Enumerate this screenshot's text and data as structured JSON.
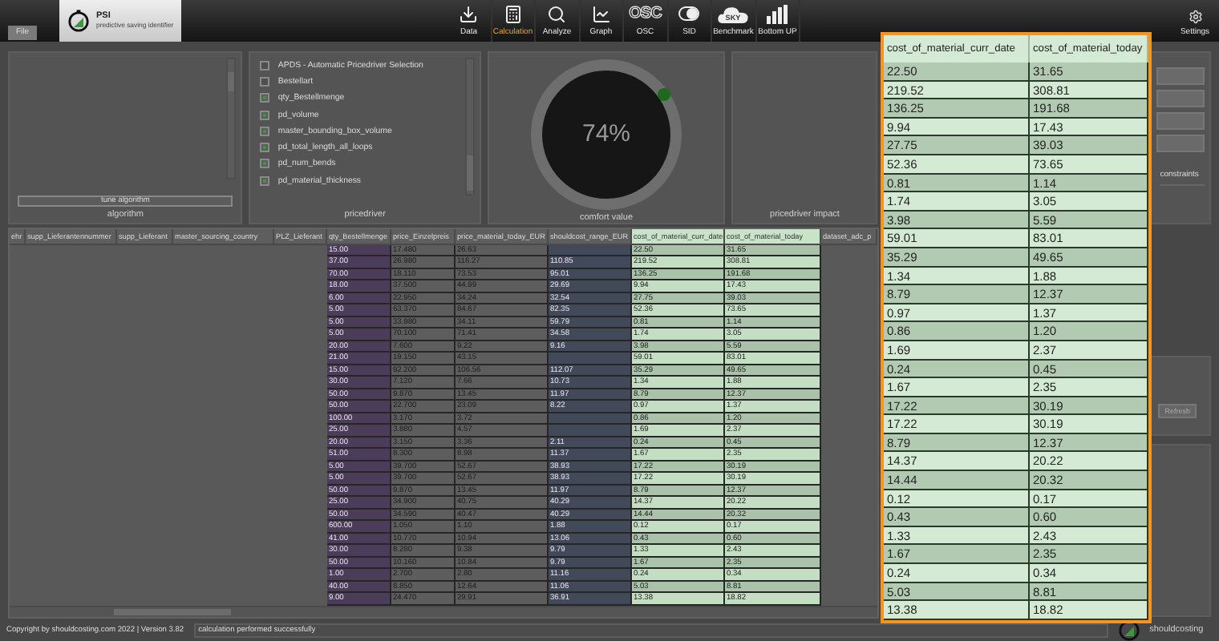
{
  "menu": {
    "file": "File"
  },
  "app_tab": {
    "title": "PSI",
    "subtitle": "predictive saving identifier"
  },
  "toolbar": [
    {
      "kind": "data",
      "label": "Data",
      "selected": false
    },
    {
      "kind": "calculation",
      "label": "Calculation",
      "selected": true
    },
    {
      "kind": "analyze",
      "label": "Analyze",
      "selected": false
    },
    {
      "kind": "graph",
      "label": "Graph",
      "selected": false
    },
    {
      "kind": "osc",
      "label": "OSC",
      "icon_text": "OSC",
      "selected": false
    },
    {
      "kind": "sid",
      "label": "SID",
      "selected": false
    },
    {
      "kind": "benchmark",
      "label": "Benchmark",
      "icon_text": "SKY",
      "selected": false
    },
    {
      "kind": "bottomup",
      "label": "Bottom UP",
      "selected": false
    }
  ],
  "settings": {
    "label": "Settings"
  },
  "algorithm_panel": {
    "button": "tune algorithm",
    "caption": "algorithm"
  },
  "pricedriver_panel": {
    "caption": "pricedriver",
    "items": [
      {
        "label": "APDS - Automatic Pricedriver Selection",
        "checked": false
      },
      {
        "label": "Bestellart",
        "checked": false
      },
      {
        "label": "qty_Bestellmenge",
        "checked": true
      },
      {
        "label": "pd_volume",
        "checked": true
      },
      {
        "label": "master_bounding_box_volume",
        "checked": true
      },
      {
        "label": "pd_total_length_all_loops",
        "checked": true
      },
      {
        "label": "pd_num_bends",
        "checked": true
      },
      {
        "label": "pd_material_thickness",
        "checked": true
      }
    ]
  },
  "comfort_panel": {
    "value": "74%",
    "caption": "comfort value"
  },
  "impact_panel": {
    "caption": "pricedriver impact"
  },
  "constraints_panel": {
    "label": "constraints"
  },
  "refresh_button": "Refresh",
  "table": {
    "columns": [
      "ehr",
      "supp_Lieferantennummer",
      "supp_Lieferant",
      "master_sourcing_country",
      "PLZ_Lieferant",
      "qty_Bestellmenge",
      "price_Einzelpreis",
      "price_material_today_EUR",
      "shouldcost_range_EUR",
      "cost_of_material_curr_date",
      "cost_of_material_today",
      "dataset_adc_p"
    ],
    "rows": [
      {
        "qty": "15.00",
        "unit_price": "17.480",
        "material_price": "26.63",
        "cost_curr": "22.50",
        "cost_today": "31.65"
      },
      {
        "qty": "37.00",
        "unit_price": "26.980",
        "material_price": "116.27",
        "shouldcost": "110.85",
        "cost_curr": "219.52",
        "cost_today": "308.81"
      },
      {
        "qty": "70.00",
        "unit_price": "18.110",
        "material_price": "73.53",
        "shouldcost": "95.01",
        "cost_curr": "136.25",
        "cost_today": "191.68"
      },
      {
        "qty": "18.00",
        "unit_price": "37.500",
        "material_price": "44.99",
        "shouldcost": "29.69",
        "cost_curr": "9.94",
        "cost_today": "17.43"
      },
      {
        "qty": "6.00",
        "unit_price": "22.950",
        "material_price": "34.24",
        "shouldcost": "32.54",
        "cost_curr": "27.75",
        "cost_today": "39.03"
      },
      {
        "qty": "5.00",
        "unit_price": "63.370",
        "material_price": "84.67",
        "shouldcost": "82.35",
        "cost_curr": "52.36",
        "cost_today": "73.65"
      },
      {
        "qty": "5.00",
        "unit_price": "33.980",
        "material_price": "34.11",
        "shouldcost": "59.79",
        "cost_curr": "0.81",
        "cost_today": "1.14"
      },
      {
        "qty": "5.00",
        "unit_price": "70.100",
        "material_price": "71.41",
        "shouldcost": "34.58",
        "cost_curr": "1.74",
        "cost_today": "3.05"
      },
      {
        "qty": "20.00",
        "unit_price": "7.600",
        "material_price": "9.22",
        "shouldcost": "9.16",
        "cost_curr": "3.98",
        "cost_today": "5.59"
      },
      {
        "qty": "21.00",
        "unit_price": "19.150",
        "material_price": "43.15",
        "cost_curr": "59.01",
        "cost_today": "83.01"
      },
      {
        "qty": "15.00",
        "unit_price": "92.200",
        "material_price": "106.56",
        "shouldcost": "112.07",
        "cost_curr": "35.29",
        "cost_today": "49.65"
      },
      {
        "qty": "30.00",
        "unit_price": "7.120",
        "material_price": "7.66",
        "shouldcost": "10.73",
        "cost_curr": "1.34",
        "cost_today": "1.88"
      },
      {
        "qty": "50.00",
        "unit_price": "9.870",
        "material_price": "13.45",
        "shouldcost": "11.97",
        "cost_curr": "8.79",
        "cost_today": "12.37"
      },
      {
        "qty": "50.00",
        "unit_price": "22.700",
        "material_price": "23.09",
        "shouldcost": "8.22",
        "cost_curr": "0.97",
        "cost_today": "1.37"
      },
      {
        "qty": "100.00",
        "unit_price": "3.170",
        "material_price": "3.72",
        "cost_curr": "0.86",
        "cost_today": "1.20"
      },
      {
        "qty": "25.00",
        "unit_price": "3.880",
        "material_price": "4.57",
        "cost_curr": "1.69",
        "cost_today": "2.37"
      },
      {
        "qty": "20.00",
        "unit_price": "3.150",
        "material_price": "3.36",
        "shouldcost": "2.11",
        "cost_curr": "0.24",
        "cost_today": "0.45"
      },
      {
        "qty": "51.00",
        "unit_price": "8.300",
        "material_price": "8.98",
        "shouldcost": "11.37",
        "cost_curr": "1.67",
        "cost_today": "2.35"
      },
      {
        "qty": "5.00",
        "unit_price": "39.700",
        "material_price": "52.67",
        "shouldcost": "38.93",
        "cost_curr": "17.22",
        "cost_today": "30.19"
      },
      {
        "qty": "5.00",
        "unit_price": "39.700",
        "material_price": "52.67",
        "shouldcost": "38.93",
        "cost_curr": "17.22",
        "cost_today": "30.19"
      },
      {
        "qty": "50.00",
        "unit_price": "9.870",
        "material_price": "13.45",
        "shouldcost": "11.97",
        "cost_curr": "8.79",
        "cost_today": "12.37"
      },
      {
        "qty": "25.00",
        "unit_price": "34.900",
        "material_price": "40.75",
        "shouldcost": "40.29",
        "cost_curr": "14.37",
        "cost_today": "20.22"
      },
      {
        "qty": "50.00",
        "unit_price": "34.590",
        "material_price": "40.47",
        "shouldcost": "40.29",
        "cost_curr": "14.44",
        "cost_today": "20.32"
      },
      {
        "qty": "600.00",
        "unit_price": "1.050",
        "material_price": "1.10",
        "shouldcost": "1.88",
        "cost_curr": "0.12",
        "cost_today": "0.17"
      },
      {
        "qty": "41.00",
        "unit_price": "10.770",
        "material_price": "10.94",
        "shouldcost": "13.06",
        "cost_curr": "0.43",
        "cost_today": "0.60"
      },
      {
        "qty": "30.00",
        "unit_price": "8.280",
        "material_price": "9.38",
        "shouldcost": "9.79",
        "cost_curr": "1.33",
        "cost_today": "2.43"
      },
      {
        "qty": "50.00",
        "unit_price": "10.160",
        "material_price": "10.84",
        "shouldcost": "9.79",
        "cost_curr": "1.67",
        "cost_today": "2.35"
      },
      {
        "qty": "1.00",
        "unit_price": "2.700",
        "material_price": "2.80",
        "shouldcost": "11.16",
        "cost_curr": "0.24",
        "cost_today": "0.34"
      },
      {
        "qty": "40.00",
        "unit_price": "8.850",
        "material_price": "12.64",
        "shouldcost": "11.06",
        "cost_curr": "5.03",
        "cost_today": "8.81"
      },
      {
        "qty": "9.00",
        "unit_price": "24.470",
        "material_price": "29.91",
        "shouldcost": "36.91",
        "cost_curr": "13.38",
        "cost_today": "18.82"
      }
    ]
  },
  "zoom_panel": {
    "columns": [
      "cost_of_material_curr_date",
      "cost_of_material_today"
    ],
    "rows": [
      [
        "22.50",
        "31.65"
      ],
      [
        "219.52",
        "308.81"
      ],
      [
        "136.25",
        "191.68"
      ],
      [
        "9.94",
        "17.43"
      ],
      [
        "27.75",
        "39.03"
      ],
      [
        "52.36",
        "73.65"
      ],
      [
        "0.81",
        "1.14"
      ],
      [
        "1.74",
        "3.05"
      ],
      [
        "3.98",
        "5.59"
      ],
      [
        "59.01",
        "83.01"
      ],
      [
        "35.29",
        "49.65"
      ],
      [
        "1.34",
        "1.88"
      ],
      [
        "8.79",
        "12.37"
      ],
      [
        "0.97",
        "1.37"
      ],
      [
        "0.86",
        "1.20"
      ],
      [
        "1.69",
        "2.37"
      ],
      [
        "0.24",
        "0.45"
      ],
      [
        "1.67",
        "2.35"
      ],
      [
        "17.22",
        "30.19"
      ],
      [
        "17.22",
        "30.19"
      ],
      [
        "8.79",
        "12.37"
      ],
      [
        "14.37",
        "20.22"
      ],
      [
        "14.44",
        "20.32"
      ],
      [
        "0.12",
        "0.17"
      ],
      [
        "0.43",
        "0.60"
      ],
      [
        "1.33",
        "2.43"
      ],
      [
        "1.67",
        "2.35"
      ],
      [
        "0.24",
        "0.34"
      ],
      [
        "5.03",
        "8.81"
      ],
      [
        "13.38",
        "18.82"
      ]
    ]
  },
  "status_bar": {
    "copyright": "Copyright by shouldcosting.com 2022 | Version 3.82",
    "message": "calculation performed successfully"
  },
  "footer_logo": {
    "name": "shouldcosting"
  }
}
